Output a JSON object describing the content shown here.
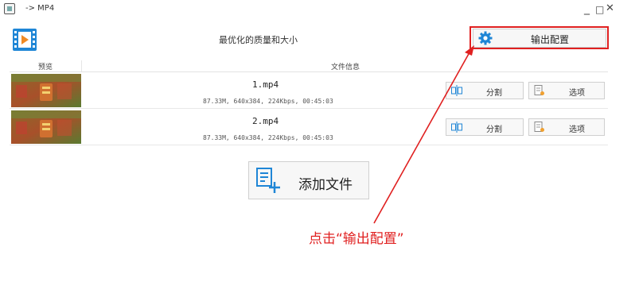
{
  "window": {
    "title": "-> MP4",
    "minimize": "_",
    "maximize": "□",
    "close": "✕"
  },
  "toolbar": {
    "quality_label": "最优化的质量和大小",
    "output_config_label": "输出配置"
  },
  "table": {
    "headers": {
      "preview": "预览",
      "info": "文件信息"
    },
    "rows": [
      {
        "name": "1.mp4",
        "meta": "87.33M, 640x384, 224Kbps, 00:45:03",
        "split_label": "分割",
        "options_label": "选项"
      },
      {
        "name": "2.mp4",
        "meta": "87.33M, 640x384, 224Kbps, 00:45:03",
        "split_label": "分割",
        "options_label": "选项"
      }
    ]
  },
  "add_file": {
    "label": "添加文件"
  },
  "annotation": {
    "text": "点击“输出配置”"
  },
  "colors": {
    "highlight": "#e02020",
    "accent": "#1f86d6"
  }
}
